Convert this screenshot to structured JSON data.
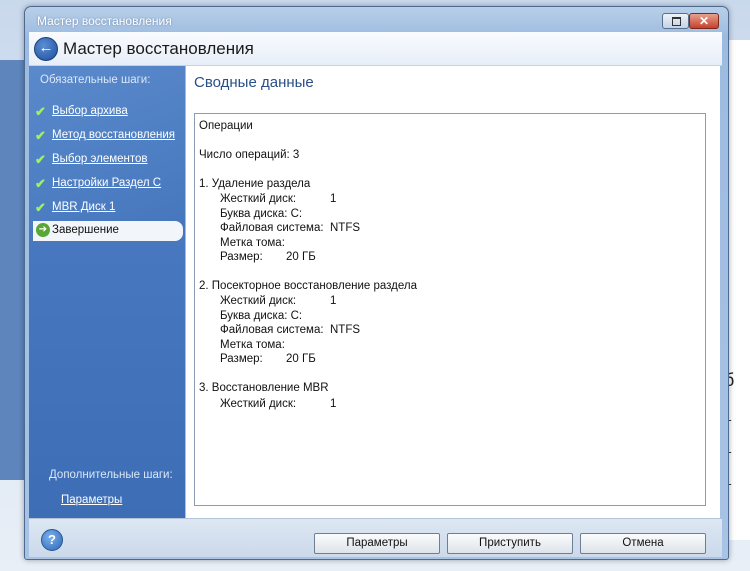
{
  "window": {
    "title": "Мастер восстановления"
  },
  "header": {
    "title": "Мастер восстановления"
  },
  "sidebar": {
    "required_heading": "Обязательные шаги:",
    "steps": [
      {
        "label": "Выбор архива",
        "state": "done"
      },
      {
        "label": "Метод восстановления",
        "state": "done"
      },
      {
        "label": "Выбор элементов",
        "state": "done"
      },
      {
        "label": "Настройки Раздел С",
        "state": "done"
      },
      {
        "label": "MBR Диск 1",
        "state": "done"
      },
      {
        "label": "Завершение",
        "state": "active"
      }
    ],
    "optional_heading": "Дополнительные шаги:",
    "optional_link": "Параметры"
  },
  "content": {
    "section_title": "Сводные данные",
    "summary": {
      "heading": "Операции",
      "count": "Число операций: 3",
      "op1": {
        "title": "1. Удаление раздела",
        "disk_label": "Жесткий диск:",
        "disk_value": "1",
        "letter_label": "Буква диска: C:",
        "fs_label": "Файловая система:",
        "fs_value": "NTFS",
        "volume_label": "Метка тома:",
        "size_label": "Размер:",
        "size_value": "20 ГБ"
      },
      "op2": {
        "title": "2. Посекторное восстановление раздела",
        "disk_label": "Жесткий диск:",
        "disk_value": "1",
        "letter_label": "Буква диска: C:",
        "fs_label": "Файловая система:",
        "fs_value": "NTFS",
        "volume_label": "Метка тома:",
        "size_label": "Размер:",
        "size_value": "20 ГБ"
      },
      "op3": {
        "title": "3. Восстановление MBR",
        "disk_label": "Жесткий диск:",
        "disk_value": "1"
      }
    }
  },
  "footer": {
    "help_glyph": "?",
    "params_button": "Параметры",
    "start_button": "Приступить",
    "cancel_button": "Отмена"
  },
  "background": {
    "right_glyphs": [
      "б",
      "–",
      "–",
      "–"
    ]
  },
  "colors": {
    "sidebar": "#4a7cc2",
    "title_blue": "#2a4f86",
    "check_green": "#9df06a"
  }
}
